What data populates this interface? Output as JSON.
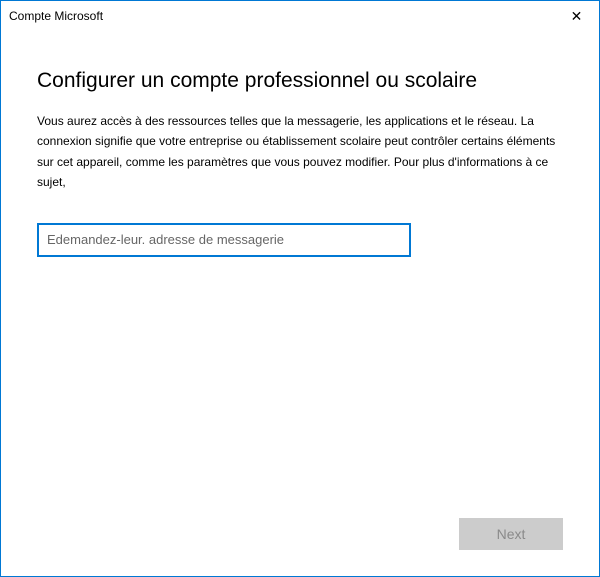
{
  "titlebar": {
    "title": "Compte Microsoft",
    "close_label": "✕"
  },
  "content": {
    "heading": "Configurer un compte professionnel ou scolaire",
    "description": "Vous aurez accès à des ressources telles que la messagerie, les applications et le réseau. La connexion signifie que votre entreprise ou établissement scolaire peut contrôler certains éléments sur cet appareil, comme les paramètres que vous pouvez modifier. Pour plus d'informations à ce sujet,",
    "email_placeholder": "Edemandez-leur. adresse de messagerie",
    "email_value": ""
  },
  "footer": {
    "next_label": "Next"
  }
}
